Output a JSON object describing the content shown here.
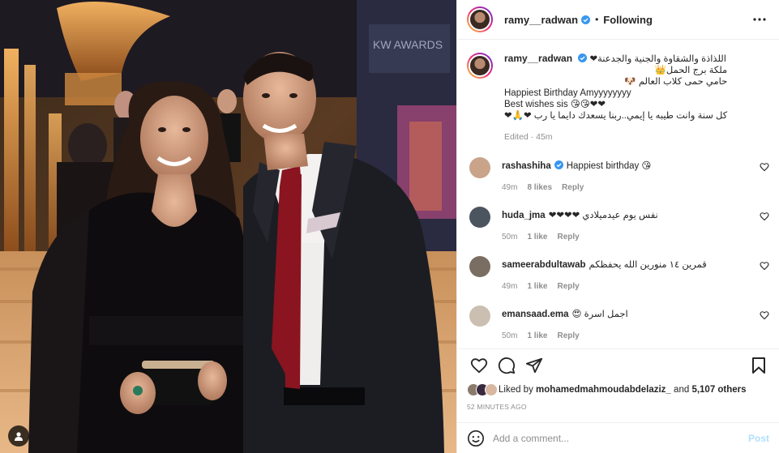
{
  "post": {
    "username": "ramy__radwan",
    "follow_state": "Following",
    "caption_lines": [
      "اللذاذة والشقاوة والجنية والجدعنة❤",
      "ملكة برج الحمل👑",
      "حامي حمى كلاب العالم 🐶",
      "Happiest Birthday Amyyyyyyyy",
      "Best wishes sis 😘😘❤❤",
      "كل سنة وانت طيبه يا إيمي..ربنا يسعدك دايما يا رب ❤🙏❤"
    ],
    "caption_meta": "Edited · 45m"
  },
  "comments": [
    {
      "user": "rashashiha",
      "verified": true,
      "text": "Happiest birthday 😘",
      "time": "49m",
      "likes": "8 likes",
      "reply": "Reply",
      "avatar_color": "#c9a48a"
    },
    {
      "user": "huda_jma",
      "verified": false,
      "text": "نفس يوم عيدميلادي ❤❤❤❤",
      "time": "50m",
      "likes": "1 like",
      "reply": "Reply",
      "avatar_color": "#4a5560"
    },
    {
      "user": "sameerabdultawab",
      "verified": false,
      "text": "قمرين ١٤ منورين الله يحفظكم",
      "time": "49m",
      "likes": "1 like",
      "reply": "Reply",
      "avatar_color": "#7a6e62"
    },
    {
      "user": "emansaad.ema",
      "verified": false,
      "text": "اجمل اسرة 😍",
      "time": "50m",
      "likes": "1 like",
      "reply": "Reply",
      "avatar_color": "#cbbfb2"
    }
  ],
  "likes": {
    "prefix": "Liked by",
    "user": "mohamedmahmoudabdelaziz_",
    "conjunction": "and",
    "others": "5,107 others"
  },
  "timestamp": "52 MINUTES AGO",
  "add_comment": {
    "placeholder": "Add a comment...",
    "post_label": "Post"
  },
  "icons": {
    "verified": "verified-badge-icon",
    "more": "more-options-icon",
    "like": "heart-icon",
    "comment": "comment-icon",
    "share": "share-icon",
    "save": "bookmark-icon",
    "emoji": "emoji-icon",
    "tag": "user-tag-icon"
  },
  "colors": {
    "verified": "#3897f0",
    "muted": "#8e8e8e",
    "post_disabled": "#b2dffc"
  }
}
